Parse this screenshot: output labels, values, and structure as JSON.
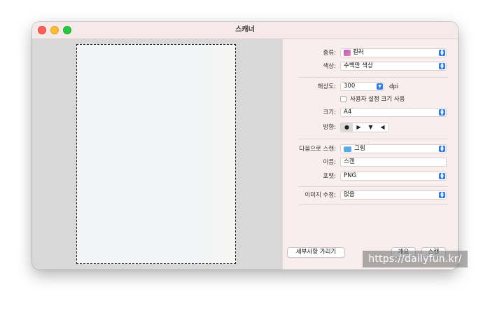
{
  "window": {
    "title": "스캐너"
  },
  "settings": {
    "kind": {
      "label": "종류:",
      "value": "컬러"
    },
    "color": {
      "label": "색상:",
      "value": "수백만 색상"
    },
    "resolution": {
      "label": "해상도:",
      "value": "300",
      "unit": "dpi"
    },
    "custom_size": {
      "label": "사용자 설정 크기 사용",
      "checked": false
    },
    "size": {
      "label": "크기:",
      "value": "A4"
    },
    "orientation": {
      "label": "방향:",
      "selected_index": 0
    },
    "scan_to": {
      "label": "다음으로 스캔:",
      "value": "그림"
    },
    "name": {
      "label": "이름:",
      "value": "스캔"
    },
    "format": {
      "label": "포맷:",
      "value": "PNG"
    },
    "image_correction": {
      "label": "이미지 수정:",
      "value": "없음"
    }
  },
  "buttons": {
    "hide_details": "세부사항 가리기",
    "overview": "개요",
    "scan": "스캔"
  },
  "watermark": "https://dailyfun.kr/",
  "colors": {
    "accent": "#2a79f0",
    "sidebar_bg": "#f9eeee",
    "preview_bg": "#d8d8d8"
  }
}
